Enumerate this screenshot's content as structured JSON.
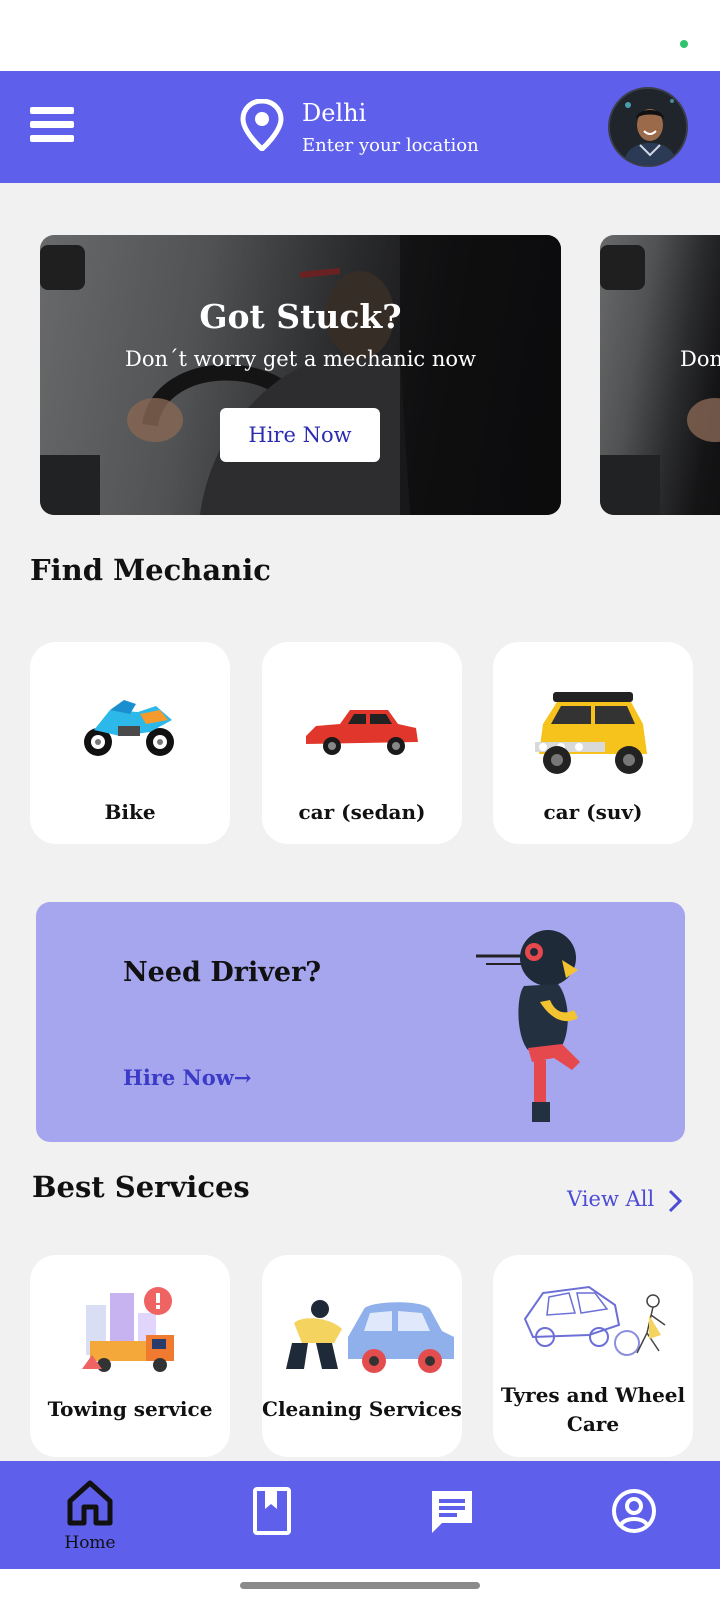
{
  "header": {
    "city": "Delhi",
    "location_hint": "Enter your location"
  },
  "banner": {
    "title": "Got Stuck?",
    "subtitle": "Don´t worry get a mechanic now",
    "button_label": "Hire Now",
    "next_subtitle_peek": "Don"
  },
  "find_mechanic": {
    "title": "Find Mechanic",
    "items": [
      {
        "label": "Bike",
        "icon": "motorbike-icon"
      },
      {
        "label": "car (sedan)",
        "icon": "sedan-car-icon"
      },
      {
        "label": "car (suv)",
        "icon": "suv-car-icon"
      }
    ]
  },
  "driver_promo": {
    "title": "Need Driver?",
    "link_label": "Hire Now",
    "link_arrow": "→"
  },
  "best_services": {
    "title": "Best Services",
    "view_all": "View All",
    "items": [
      {
        "label": "Towing service",
        "icon": "tow-truck-icon"
      },
      {
        "label": "Cleaning Services",
        "icon": "car-wash-icon"
      },
      {
        "label": "Tyres and Wheel Care",
        "icon": "tyre-service-icon"
      }
    ]
  },
  "bottom_nav": {
    "items": [
      {
        "label": "Home",
        "icon": "home-icon",
        "active": true
      },
      {
        "label": "",
        "icon": "bookmark-icon"
      },
      {
        "label": "",
        "icon": "chat-icon"
      },
      {
        "label": "",
        "icon": "profile-icon"
      }
    ]
  },
  "colors": {
    "primary": "#5e5feb",
    "promo_bg": "#a6a6ef",
    "link": "#4b4bd6",
    "background": "#f1f1f1"
  }
}
